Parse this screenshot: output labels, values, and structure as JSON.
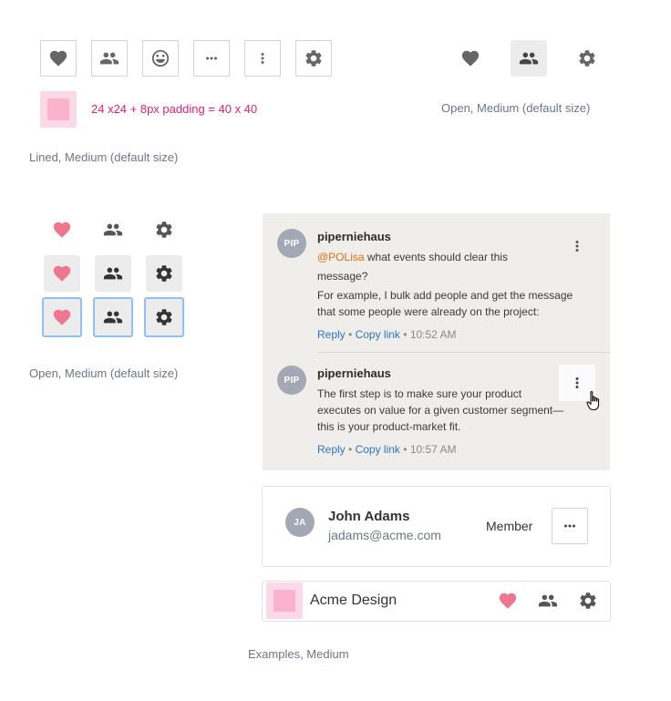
{
  "colors": {
    "icon_gray": "#666666",
    "icon_dark": "#4a4a4a",
    "heart_pink": "#f0758e",
    "focus_blue": "#8ec0f5",
    "spec_magenta": "#e0217a",
    "mention_orange": "#e0710f",
    "link_blue": "#2d74c6"
  },
  "lined_section": {
    "icons": [
      "heart-icon",
      "people-icon",
      "smiley-icon",
      "horizontal-dots-icon",
      "vertical-dots-icon",
      "gear-icon"
    ],
    "spec_text": "24 x24 + 8px padding = 40 x 40",
    "caption": "Lined, Medium (default size)"
  },
  "open_section_top": {
    "icons": [
      "heart-icon",
      "people-icon",
      "gear-icon"
    ],
    "caption": "Open, Medium (default size)"
  },
  "open_states": {
    "rows": [
      "default",
      "hover",
      "focus"
    ],
    "icons": [
      "heart-icon",
      "people-icon",
      "gear-icon"
    ],
    "caption": "Open, Medium (default size)"
  },
  "comments": [
    {
      "initials": "PIP",
      "username": "piperniehaus",
      "mention": "@POLisa",
      "lines": [
        " what events should clear this",
        "message?",
        "For example, I bulk add people and get the message",
        "that some people were already on the project:"
      ],
      "reply": "Reply",
      "copy": "Copy link",
      "time": "10:52 AM"
    },
    {
      "initials": "PIP",
      "username": "piperniehaus",
      "lines": [
        "The first step is to make sure your product",
        "executes on value for a given customer segment—",
        "this is your product-market fit."
      ],
      "reply": "Reply",
      "copy": "Copy link",
      "time": "10:57 AM"
    }
  ],
  "separator": "•",
  "member": {
    "initials": "JA",
    "name": "John Adams",
    "email": "jadams@acme.com",
    "role": "Member"
  },
  "acme": {
    "name": "Acme Design"
  },
  "examples_caption": "Examples, Medium"
}
